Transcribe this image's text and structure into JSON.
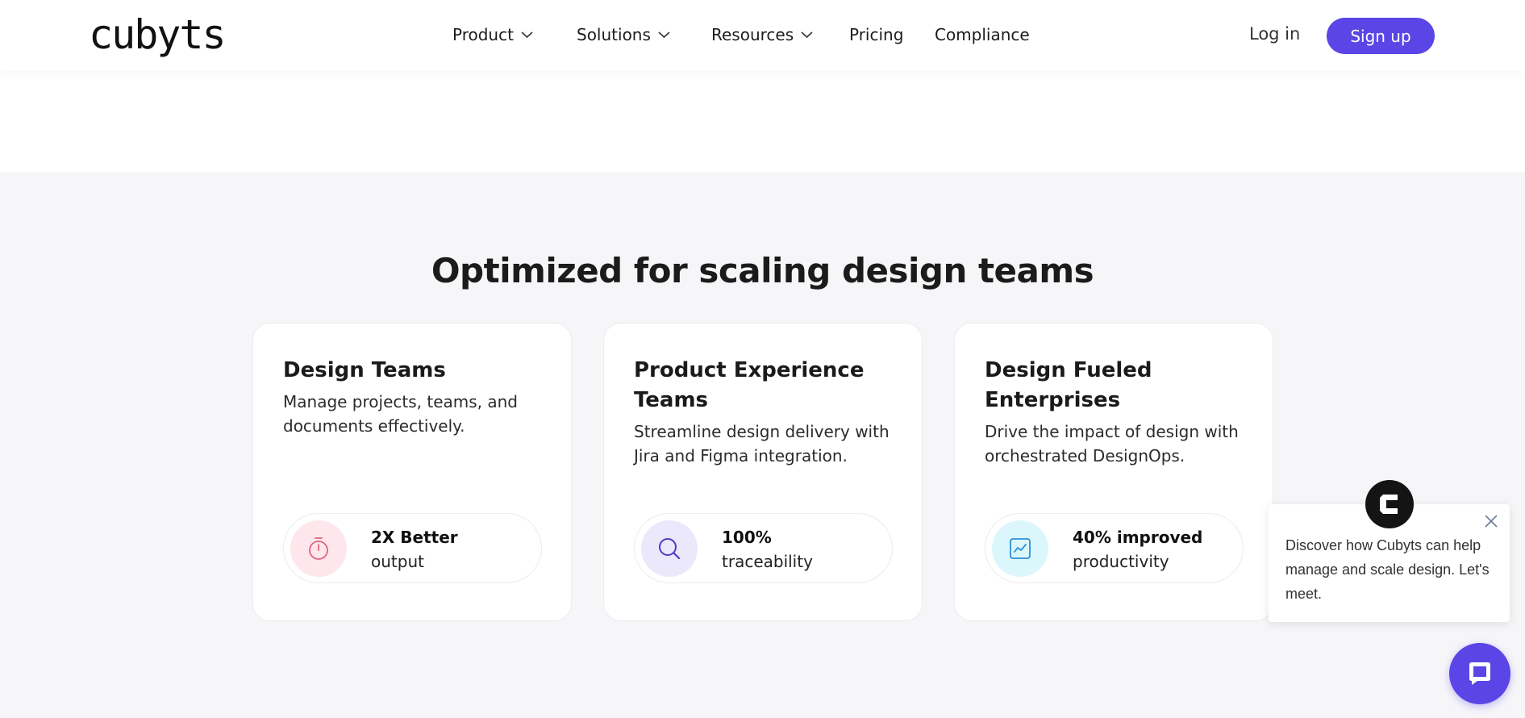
{
  "header": {
    "logo_text": "cubyts",
    "nav": [
      {
        "label": "Product",
        "has_dropdown": true
      },
      {
        "label": "Solutions",
        "has_dropdown": true
      },
      {
        "label": "Resources",
        "has_dropdown": true
      },
      {
        "label": "Pricing",
        "has_dropdown": false
      },
      {
        "label": "Compliance",
        "has_dropdown": false
      }
    ],
    "login_label": "Log in",
    "signup_label": "Sign up"
  },
  "section": {
    "title": "Optimized for scaling design teams",
    "cards": [
      {
        "title": "Design Teams",
        "description": "Manage projects, teams, and documents effectively.",
        "stat_bold": "2X Better",
        "stat_rest": "output",
        "icon": "stopwatch-icon",
        "icon_bg": "#fde7ec",
        "icon_color": "#e0627e"
      },
      {
        "title": "Product Experience Teams",
        "description": "Streamline design delivery with Jira and Figma integration.",
        "stat_bold": "100%",
        "stat_rest": "traceability",
        "icon": "search-icon",
        "icon_bg": "#ebe8fb",
        "icon_color": "#4b3cc4"
      },
      {
        "title": "Design Fueled Enterprises",
        "description": "Drive the impact of design with orchestrated DesignOps.",
        "stat_bold": "40% improved",
        "stat_rest": "productivity",
        "icon": "trend-chart-icon",
        "icon_bg": "#dcf7fb",
        "icon_color": "#2a8fd6"
      }
    ]
  },
  "chat": {
    "message": "Discover how Cubyts can help manage and scale design. Let's meet.",
    "avatar_icon": "cubyts-logo-icon",
    "button_icon": "chat-bubble-icon"
  },
  "colors": {
    "accent": "#5b45e6",
    "section_bg": "#f6f6f9"
  }
}
